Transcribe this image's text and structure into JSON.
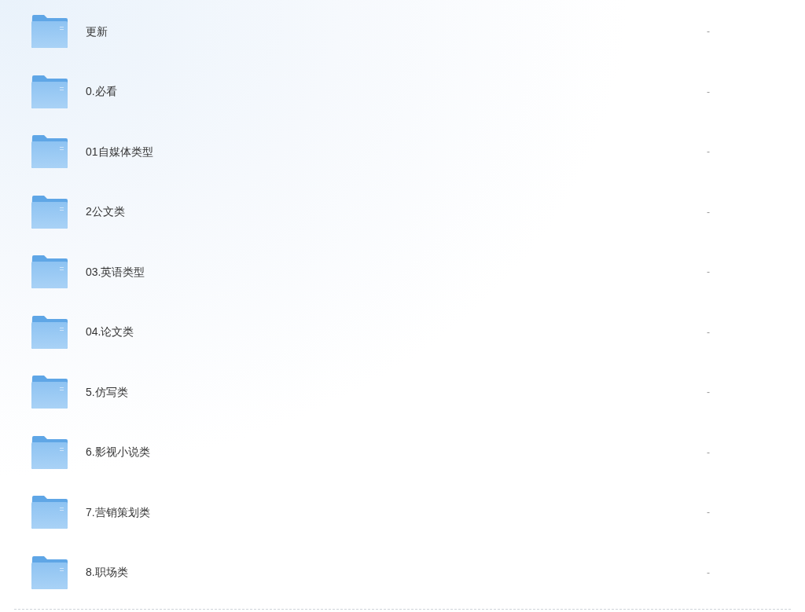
{
  "files": [
    {
      "name": "更新",
      "size": "-"
    },
    {
      "name": "0.必看",
      "size": "-"
    },
    {
      "name": "01自媒体类型",
      "size": "-"
    },
    {
      "name": "2公文类",
      "size": "-"
    },
    {
      "name": "03.英语类型",
      "size": "-"
    },
    {
      "name": "04.论文类",
      "size": "-"
    },
    {
      "name": "5.仿写类",
      "size": "-"
    },
    {
      "name": "6.影视小说类",
      "size": "-"
    },
    {
      "name": "7.营销策划类",
      "size": "-"
    },
    {
      "name": "8.职场类",
      "size": "-"
    }
  ]
}
